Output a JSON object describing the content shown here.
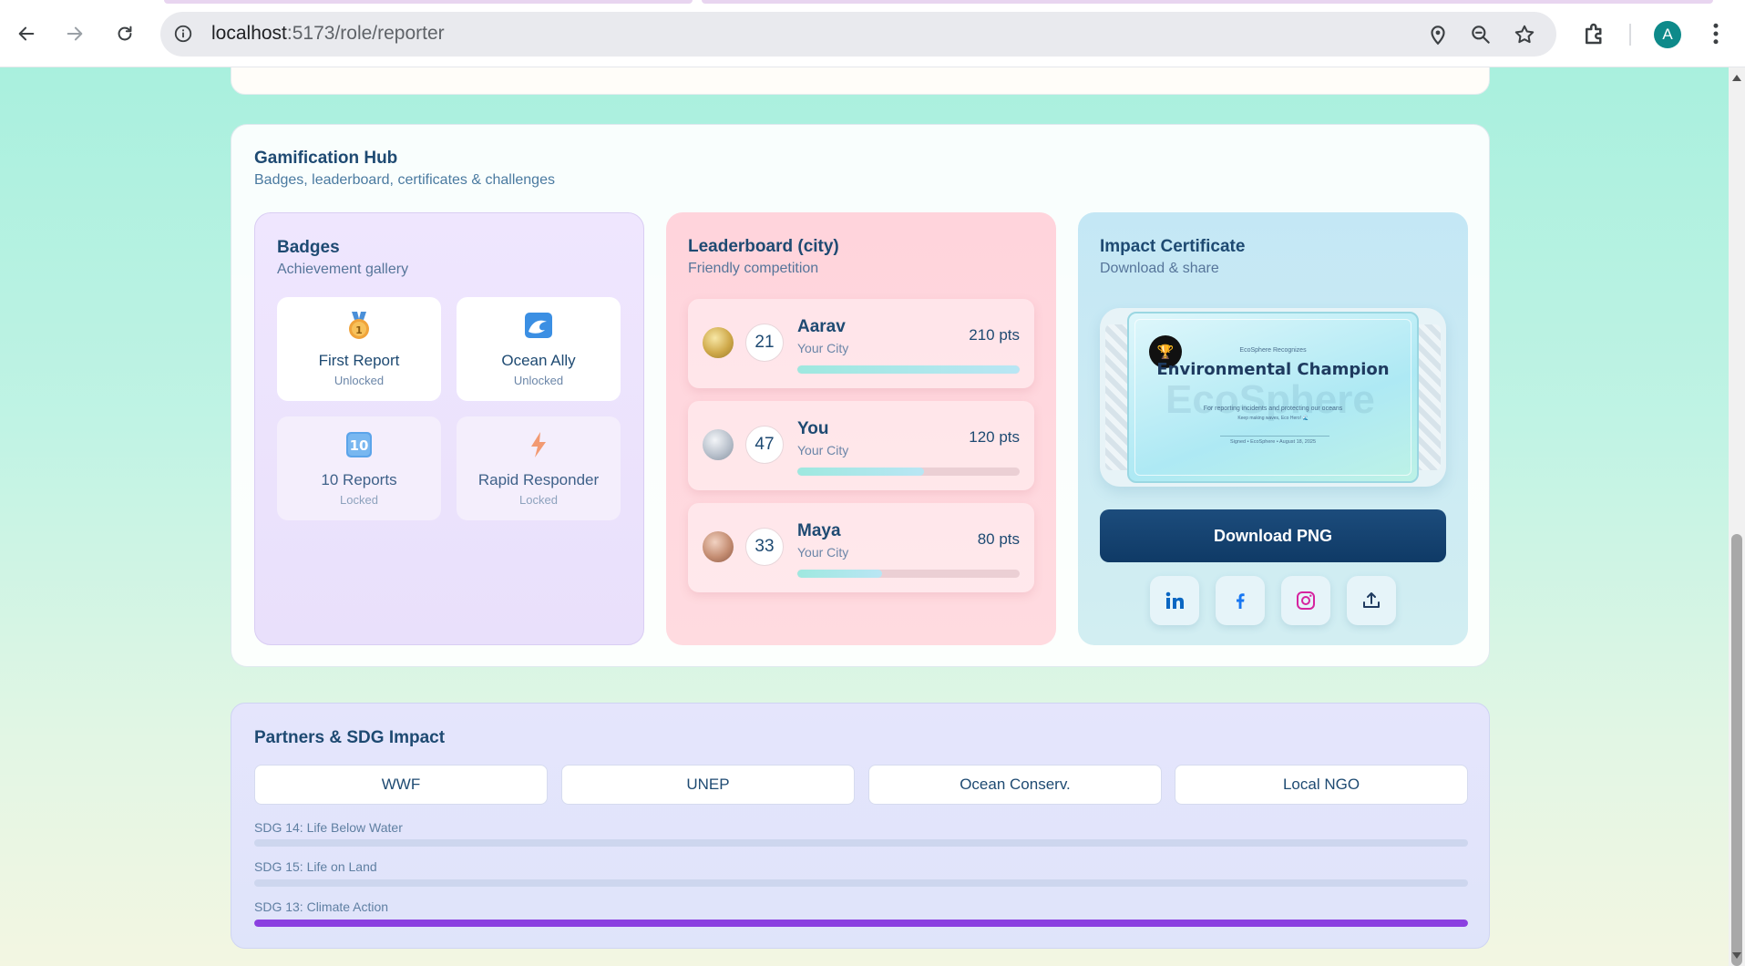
{
  "browser": {
    "url_host": "localhost",
    "url_path": ":5173/role/reporter",
    "avatar_letter": "A"
  },
  "hub": {
    "title": "Gamification Hub",
    "subtitle": "Badges, leaderboard, certificates & challenges"
  },
  "badges": {
    "title": "Badges",
    "subtitle": "Achievement gallery",
    "items": [
      {
        "name": "First Report",
        "state": "Unlocked",
        "icon": "medal-icon"
      },
      {
        "name": "Ocean Ally",
        "state": "Unlocked",
        "icon": "wave-icon"
      },
      {
        "name": "10 Reports",
        "state": "Locked",
        "icon": "keycap-ten-icon"
      },
      {
        "name": "Rapid Responder",
        "state": "Locked",
        "icon": "lightning-icon"
      }
    ]
  },
  "leaderboard": {
    "title": "Leaderboard (city)",
    "subtitle": "Friendly competition",
    "rows": [
      {
        "rank": "21",
        "name": "Aarav",
        "city": "Your City",
        "points": "210 pts",
        "progress": 1.0,
        "medal": "gold"
      },
      {
        "rank": "47",
        "name": "You",
        "city": "Your City",
        "points": "120 pts",
        "progress": 0.57,
        "medal": "silver"
      },
      {
        "rank": "33",
        "name": "Maya",
        "city": "Your City",
        "points": "80 pts",
        "progress": 0.38,
        "medal": "bronze"
      }
    ]
  },
  "certificate": {
    "title": "Impact Certificate",
    "subtitle": "Download & share",
    "recognizes": "EcoSphere Recognizes",
    "cert_title": "Environmental Champion",
    "for_text": "For reporting incidents and protecting our oceans",
    "keep_text": "Keep making waves, Eco Hero! 🌊",
    "signed": "Signed • EcoSphere • August 18, 2025",
    "watermark": "EcoSphere",
    "download_label": "Download PNG",
    "share": [
      "linkedin-icon",
      "facebook-icon",
      "instagram-icon",
      "share-upload-icon"
    ]
  },
  "partners": {
    "title": "Partners & SDG Impact",
    "items": [
      "WWF",
      "UNEP",
      "Ocean Conserv.",
      "Local NGO"
    ],
    "sdgs": [
      {
        "label": "SDG 14: Life Below Water",
        "progress": 0.0,
        "color": "#8b3fe0"
      },
      {
        "label": "SDG 15: Life on Land",
        "progress": 0.0,
        "color": "#8b3fe0"
      },
      {
        "label": "SDG 13: Climate Action",
        "progress": 1.0,
        "color": "#8b3fe0"
      }
    ]
  },
  "colors": {
    "accent_dark": "#0f3a66",
    "heading": "#1e4a72",
    "sdg_fill": "#8b3fe0"
  }
}
